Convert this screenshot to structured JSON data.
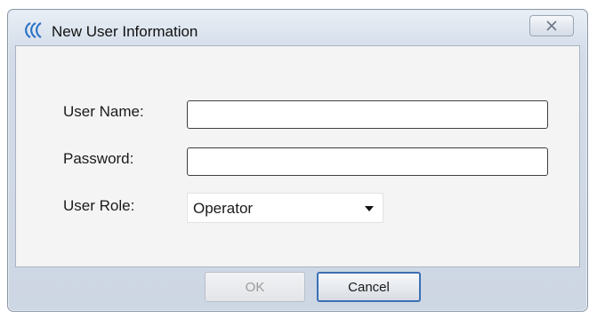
{
  "window": {
    "title": "New User Information",
    "close_glyph": "✕"
  },
  "form": {
    "username_label": "User Name:",
    "username_value": "",
    "password_label": "Password:",
    "password_value": "",
    "role_label": "User Role:",
    "role_value": "Operator"
  },
  "buttons": {
    "ok_label": "OK",
    "cancel_label": "Cancel"
  },
  "icons": {
    "app_logo": "app-logo-icon",
    "close": "close-icon",
    "dropdown": "chevron-down-icon"
  },
  "colors": {
    "accent_border": "#3b6fb5",
    "logo_blue": "#2a72c4",
    "disabled_text": "#9b9b9b"
  }
}
